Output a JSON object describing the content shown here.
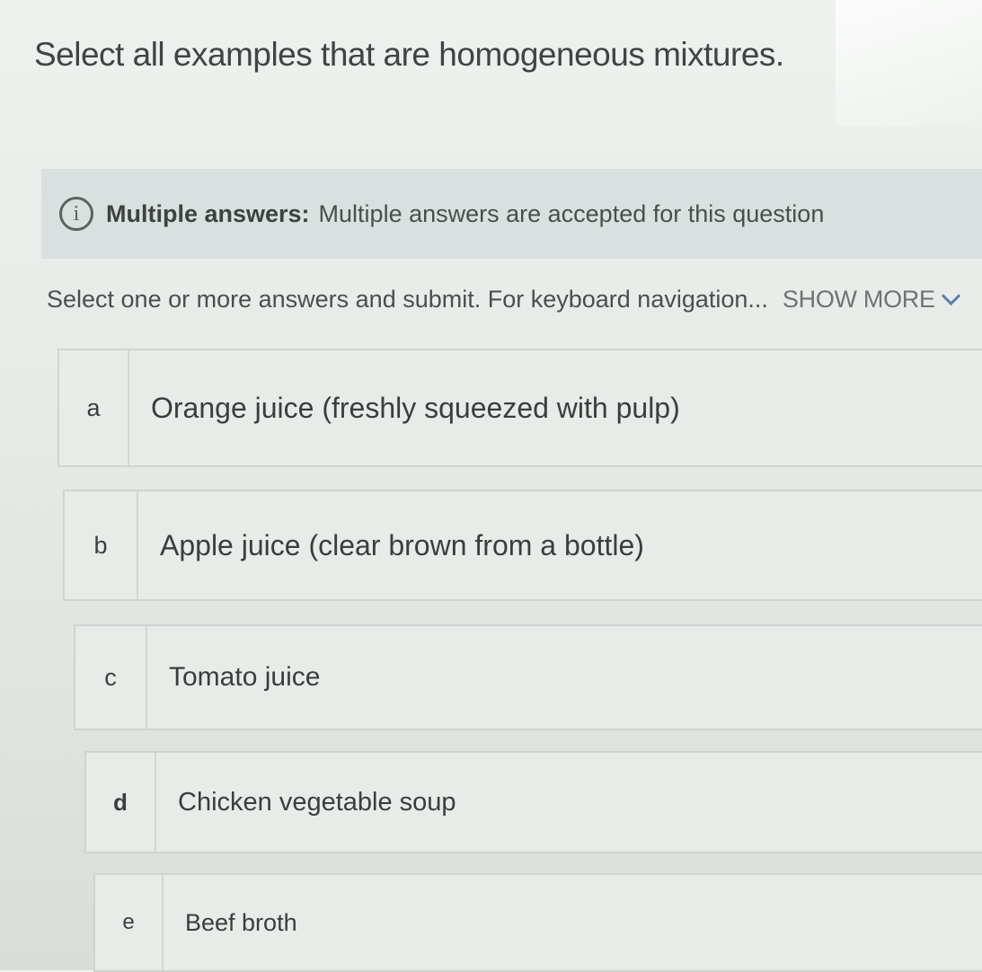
{
  "question": {
    "title": "Select all examples that are homogeneous mixtures."
  },
  "info_banner": {
    "icon": "info-icon",
    "icon_glyph": "i",
    "label": "Multiple answers:",
    "text": "Multiple answers are accepted for this question"
  },
  "instructions": {
    "text": "Select one or more answers and submit. For keyboard navigation...",
    "show_more_label": "SHOW MORE"
  },
  "options": [
    {
      "letter": "a",
      "text": "Orange juice (freshly squeezed with pulp)"
    },
    {
      "letter": "b",
      "text": "Apple juice (clear brown from a bottle)"
    },
    {
      "letter": "c",
      "text": "Tomato juice"
    },
    {
      "letter": "d",
      "text": "Chicken vegetable soup"
    },
    {
      "letter": "e",
      "text": "Beef broth"
    }
  ],
  "colors": {
    "background": "#e8ece8",
    "banner_background": "#d9e1e0",
    "show_more_chevron": "#5a7fb0"
  }
}
